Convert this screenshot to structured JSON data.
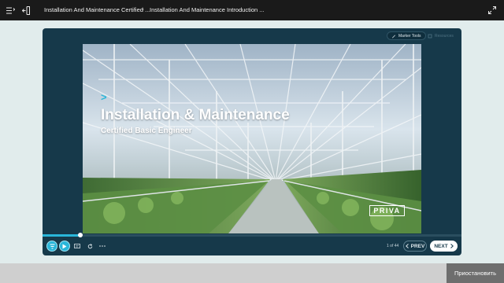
{
  "header": {
    "breadcrumb_course": "Installation And Maintenance Certified ...",
    "breadcrumb_separator": "›",
    "breadcrumb_lesson": "Installation And Maintenance Introduction ..."
  },
  "player": {
    "tools": {
      "marker_label": "Marker Tools",
      "resources_label": "Resources"
    },
    "slide": {
      "accent": ">",
      "title": "Installation & Maintenance",
      "subtitle": "Certified Basic Engineer",
      "logo_text": "PRIVA"
    },
    "progress_fraction": 0.09,
    "page_counter": "1 of 44",
    "prev_label": "PREV",
    "next_label": "NEXT"
  },
  "footer": {
    "pause_label": "Приостановить"
  },
  "colors": {
    "accent": "#29b6d9",
    "player_bg": "#16394a",
    "topbar_bg": "#1a1a1a",
    "page_bg": "#e1ecec"
  },
  "icons": [
    "menu-icon",
    "exit-icon",
    "fullscreen-icon",
    "marker-icon",
    "resources-icon",
    "filter-icon",
    "play-icon",
    "captions-icon",
    "replay-icon",
    "more-icon",
    "chevron-left-icon",
    "chevron-right-icon"
  ]
}
